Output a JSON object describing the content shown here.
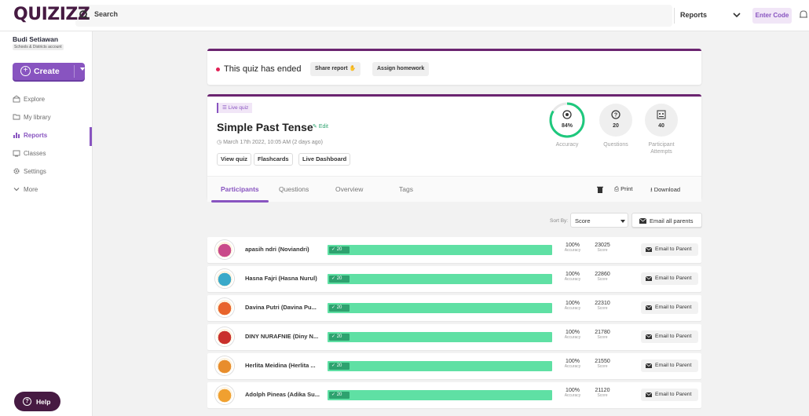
{
  "topbar": {
    "logo": "QUIZIZZ",
    "search_label": "Search",
    "reports_dropdown": "Reports",
    "enter_code": "Enter Code"
  },
  "sidebar": {
    "user_name": "Budi Setiawan",
    "account_type": "Schools & Districts account",
    "create_label": "Create",
    "items": [
      {
        "label": "Explore",
        "icon": "explore-icon"
      },
      {
        "label": "My library",
        "icon": "folder-icon"
      },
      {
        "label": "Reports",
        "icon": "reports-icon"
      },
      {
        "label": "Classes",
        "icon": "classes-icon"
      },
      {
        "label": "Settings",
        "icon": "gear-icon"
      },
      {
        "label": "More",
        "icon": "chevron-down-icon"
      }
    ],
    "help_label": "Help"
  },
  "ended": {
    "text": "This quiz has ended",
    "share_report": "Share report",
    "assign_homework": "Assign homework"
  },
  "quiz": {
    "tag": "Live quiz",
    "title": "Simple Past Tense",
    "edit": "Edit",
    "date": "March 17th 2022, 10:05 AM (2 days ago)",
    "buttons": [
      "View quiz",
      "Flashcards",
      "Live Dashboard"
    ],
    "stats": {
      "accuracy_value": "84%",
      "accuracy_fraction": 0.84,
      "accuracy_label": "Accuracy",
      "questions_value": "20",
      "questions_label": "Questions",
      "attempts_value": "40",
      "attempts_label_1": "Participant",
      "attempts_label_2": "Attempts"
    },
    "tabs": [
      "Participants",
      "Questions",
      "Overview",
      "Tags"
    ],
    "tools": {
      "print": "Print",
      "download": "Download"
    }
  },
  "sort": {
    "label": "Sort By:",
    "value": "Score",
    "email_all": "Email all parents"
  },
  "participants": [
    {
      "name": "apasih ndri (Noviandri)",
      "correct": "20",
      "accuracy": "100%",
      "score": "23025",
      "color": "#c94a8a"
    },
    {
      "name": "Hasna Fajri (Hasna Nurul)",
      "correct": "20",
      "accuracy": "100%",
      "score": "22860",
      "color": "#3aa9c9"
    },
    {
      "name": "Davina Putri (Davina Pu...",
      "correct": "20",
      "accuracy": "100%",
      "score": "22310",
      "color": "#e8642c"
    },
    {
      "name": "DINY NURAFNIE (Diny N...",
      "correct": "20",
      "accuracy": "100%",
      "score": "21780",
      "color": "#c9302c"
    },
    {
      "name": "Herlita Meidina (Herlita ...",
      "correct": "20",
      "accuracy": "100%",
      "score": "21550",
      "color": "#e88d2c"
    },
    {
      "name": "Adolph Pineas (Adika Su...",
      "correct": "20",
      "accuracy": "100%",
      "score": "21120",
      "color": "#f0a030"
    }
  ],
  "row_labels": {
    "accuracy": "Accuracy",
    "score": "Score",
    "email": "Email to Parent"
  }
}
